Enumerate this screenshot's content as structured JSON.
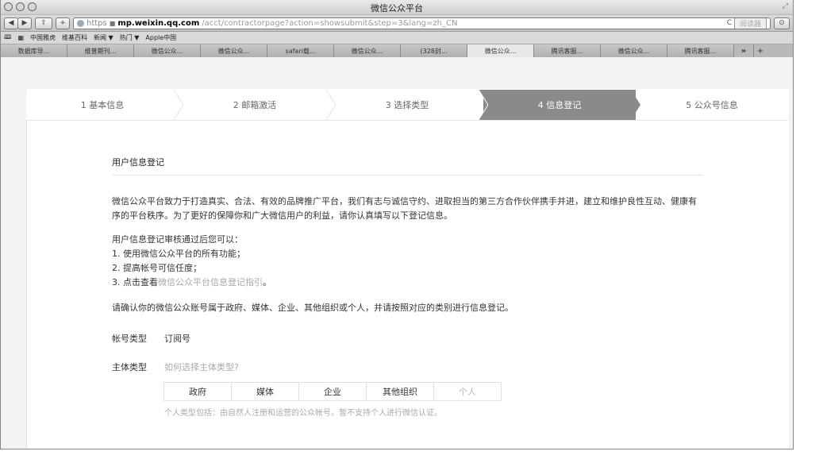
{
  "window": {
    "title": "微信公众平台"
  },
  "toolbar": {
    "back": "◀",
    "forward": "▶",
    "share": "⇪",
    "add": "+",
    "url_https": "https",
    "url_domain": "mp.weixin.qq.com",
    "url_path": "/acct/contractorpage?action=showsubmit&step=3&lang=zh_CN",
    "reload": "C",
    "reader": "阅读器"
  },
  "bookmarks": [
    "中国雅虎",
    "维基百科",
    "新闻 ▼",
    "热门 ▼",
    "Apple中国"
  ],
  "tabs": [
    "数据库导...",
    "维普期刊...",
    "微信公众...",
    "微信公众...",
    "safari载...",
    "微信公众...",
    "(328封...",
    "微信公众...",
    "腾讯客服...",
    "微信公众...",
    "腾讯客服..."
  ],
  "tabs_active_index": 7,
  "tabs_more": "»",
  "tabs_add": "+",
  "steps": [
    "1 基本信息",
    "2 邮箱激活",
    "3 选择类型",
    "4 信息登记",
    "5 公众号信息"
  ],
  "active_step_index": 3,
  "section": {
    "title": "用户信息登记",
    "intro": "微信公众平台致力于打造真实、合法、有效的品牌推广平台，我们有志与诚信守约、进取担当的第三方合作伙伴携手并进，建立和维护良性互动、健康有序的平台秩序。为了更好的保障你和广大微信用户的利益，请你认真填写以下登记信息。",
    "benefits_title": "用户信息登记审核通过后您可以：",
    "benefit1": "1. 使用微信公众平台的所有功能；",
    "benefit2": "2. 提高帐号可信任度；",
    "benefit3_prefix": "3. 点击查看",
    "benefit3_link": "微信公众平台信息登记指引",
    "benefit3_suffix": "。",
    "confirm": "请确认你的微信公众账号属于政府、媒体、企业、其他组织或个人，并请按照对应的类别进行信息登记。",
    "account_type_label": "帐号类型",
    "account_type_value": "订阅号",
    "subject_label": "主体类型",
    "subject_help_link": "如何选择主体类型?",
    "subject_options": [
      "政府",
      "媒体",
      "企业",
      "其他组织",
      "个人"
    ],
    "subject_disabled_index": 4,
    "note": "个人类型包括：由自然人注册和运营的公众帐号。暂不支持个人进行微信认证。"
  }
}
